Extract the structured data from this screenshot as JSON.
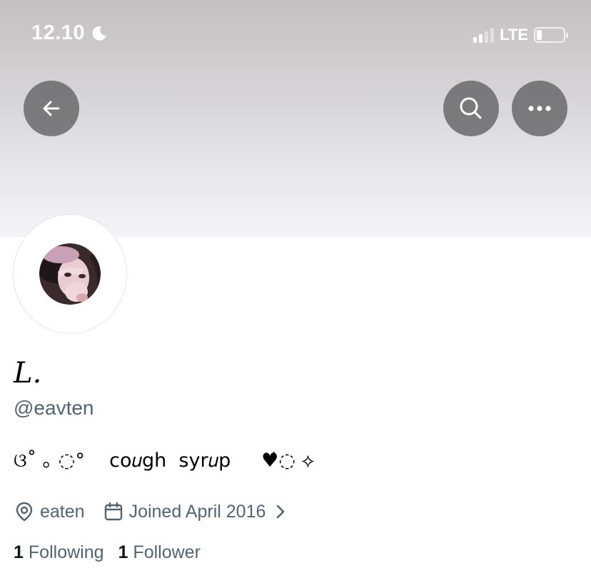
{
  "status_bar": {
    "time": "12.10",
    "network": "LTE",
    "signal_bars_active": 2,
    "signal_bars_total": 4,
    "battery_level": 0.2
  },
  "nav": {
    "back_icon": "arrow-left-icon",
    "search_icon": "search-icon",
    "more_icon": "more-horizontal-icon"
  },
  "colors": {
    "banner_top": "#c3bfc3",
    "banner_bottom": "#f5f3f6",
    "nav_button_bg": "#5f5f62",
    "secondary_text": "#536471",
    "primary_text": "#0f1419"
  },
  "profile": {
    "display_name": "L.",
    "handle": "@eavten",
    "bio": "ଓ˚ ｡ ◌°    co𝑢gh  syr𝑢p     ♥̇◌ ⟡",
    "location": "eaten",
    "joined": "Joined April 2016",
    "following_count": "1",
    "following_label": "Following",
    "followers_count": "1",
    "followers_label": "Follower"
  }
}
